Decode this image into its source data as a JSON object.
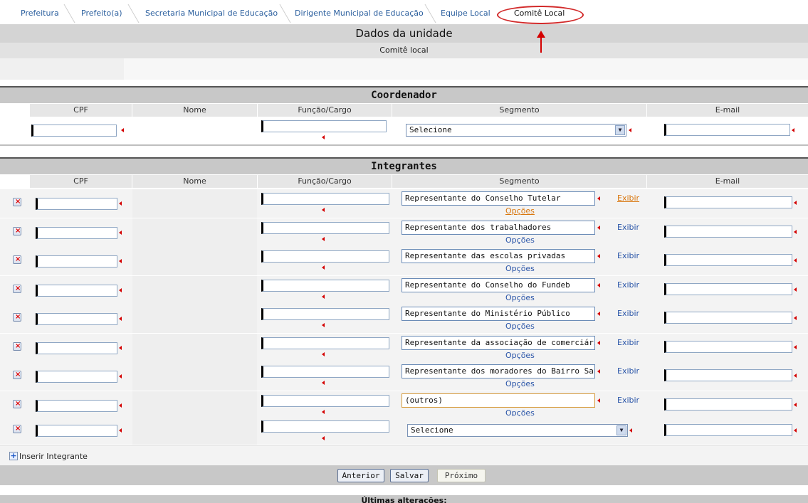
{
  "tabs": [
    {
      "label": "Prefeitura"
    },
    {
      "label": "Prefeito(a)"
    },
    {
      "label": "Secretaria Municipal de Educação"
    },
    {
      "label": "Dirigente Municipal de Educação"
    },
    {
      "label": "Equipe Local"
    },
    {
      "label": "Comitê Local",
      "active": true
    }
  ],
  "page_title": "Dados da unidade",
  "subtitle": "Comitê local",
  "coordenador": {
    "title": "Coordenador",
    "headers": [
      "CPF",
      "Nome",
      "Função/Cargo",
      "Segmento",
      "E-mail"
    ],
    "segmento_value": "Selecione"
  },
  "integrantes": {
    "title": "Integrantes",
    "headers": [
      "CPF",
      "Nome",
      "Função/Cargo",
      "Segmento",
      "E-mail"
    ],
    "rows": [
      {
        "segmento": "Representante do Conselho Tutelar",
        "exibir": "Exibir",
        "opcoes": "Opções"
      },
      {
        "segmento": "Representante dos trabalhadores",
        "exibir": "Exibir",
        "opcoes": "Opções"
      },
      {
        "segmento": "Representante das escolas privadas",
        "exibir": "Exibir",
        "opcoes": "Opções"
      },
      {
        "segmento": "Representante do Conselho do Fundeb",
        "exibir": "Exibir",
        "opcoes": "Opções"
      },
      {
        "segmento": "Representante do Ministério Público",
        "exibir": "Exibir",
        "opcoes": "Opções"
      },
      {
        "segmento": "Representante da associação de comerciário",
        "exibir": "Exibir",
        "opcoes": "Opções"
      },
      {
        "segmento": "Representante dos moradores do Bairro San",
        "exibir": "Exibir",
        "opcoes": "Opções"
      },
      {
        "segmento": "(outros)",
        "exibir": "Exibir",
        "opcoes": "Opções"
      }
    ],
    "last_row_select": "Selecione"
  },
  "insert_label": "Inserir Integrante",
  "buttons": {
    "anterior": "Anterior",
    "salvar": "Salvar",
    "proximo": "Próximo"
  },
  "last_changes": "Últimas alterações:",
  "colors": {
    "highlight": "#d22a2a",
    "link": "#2a55a8",
    "active_link": "#d9770f",
    "header_gray": "#c8c8c8"
  }
}
